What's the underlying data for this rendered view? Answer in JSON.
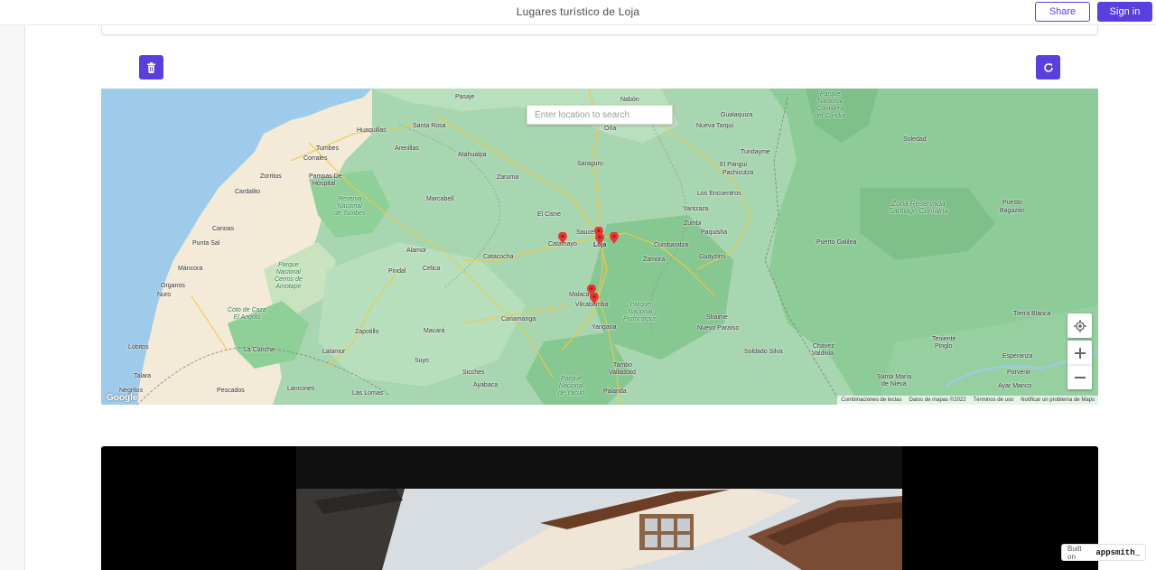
{
  "header": {
    "title": "Lugares turístico de Loja",
    "share_label": "Share",
    "signin_label": "Sign in"
  },
  "toolbar": {
    "delete_icon": "trash-icon",
    "refresh_icon": "refresh-icon"
  },
  "map": {
    "search_placeholder": "Enter location to search",
    "labels": {
      "pasaje": "Pasaje",
      "nabon": "Nabón",
      "gualaquiza": "Gualaquiza",
      "nueva_tarqui": "Nueva Tarqui",
      "huaquillas": "Huaquillas",
      "santa_rosa": "Santa Rosa",
      "ona": "Oña",
      "tumbes": "Tumbes",
      "corrales": "Corrales",
      "arenillas": "Arenillas",
      "atahualpa": "Atahualpa",
      "saraguro": "Saraguro",
      "tundayme": "Tundayme",
      "el_pangui": "El Pangui",
      "pachicutza": "Pachicutza",
      "soledad": "Soledad",
      "zorritos": "Zorritos",
      "pampas": "Pampas De",
      "hospital": "Hospital",
      "zaruma": "Zaruma",
      "cardalito": "Cardalito",
      "marcabeli": "Marcabelí",
      "los_encuentros": "Los Encuentros",
      "yantzaza": "Yantzaza",
      "zumbi": "Zumbi",
      "paquisha": "Paquisha",
      "el_cisne": "El Cisne",
      "canoas": "Canoas",
      "punta_sal": "Punta Sal",
      "catamayo": "Catamayo",
      "sauce": "Sauce",
      "loja": "Loja",
      "cumbaratza": "Cumbaratza",
      "puerto_galilea": "Puerto Galilea",
      "puesto": "Puesto",
      "bagazan": "Bagazán",
      "alamor": "Alamor",
      "catacocha": "Catacocha",
      "zamora": "Zamora",
      "guayzimi": "Guayzimi",
      "mancora": "Máncora",
      "pindal": "Pindal",
      "celica": "Celica",
      "organos": "Organos",
      "nuro": "Nuro",
      "malacatos": "Malacatos",
      "vilcabamba": "Vilcabamba",
      "yangana": "Yangana",
      "cariamanga": "Cariamanga",
      "zapotillo": "Zapotillo",
      "macara": "Macará",
      "shaime": "Shaime",
      "nuevo_paraiso": "Nuevo Paraíso",
      "tierra_blanca": "Tierra Blanca",
      "lobitos": "Lobitos",
      "la_cancha": "La Cancha",
      "lalamor": "Lalamor",
      "suyo": "Suyo",
      "soldado_silva": "Soldado Silva",
      "chavez": "Chávez",
      "valdivia": "Valdivia",
      "teniente": "Teniente",
      "pinglo": "Pinglo",
      "esperanza": "Esperanza",
      "tambo": "Tambo",
      "valladolid": "Valladolid",
      "talara": "Talara",
      "sicches": "Sicches",
      "ayabaca": "Ayabaca",
      "porvenir": "Porvenir",
      "santa_maria": "Santa María",
      "de_nieva": "de Nieva",
      "ayar_manco": "Ayar Manco",
      "negritos": "Negritos",
      "pescados": "Pescados",
      "lancones": "Lancones",
      "las_lomas": "Las Lomas",
      "palanda": "Palanda"
    },
    "parks": {
      "condor": "Parque\nNacional\nCordillera\ndel Cóndor",
      "tumbes": "Reserva\nNacional\nde Tumbes",
      "amotape": "Parque\nNacional\nCerros de\nAmotape",
      "coto": "Coto de Caza\nEl Angolo",
      "podocarpus": "Parque\nNacional\nPodocarpus",
      "santiago": "Zona Reservada\nSantiago Comaina",
      "yacuri": "Parque\nNacional\nde Yacuri"
    },
    "attribution": {
      "shortcuts": "Combinaciones de teclas",
      "data": "Datos de mapas ©2022",
      "terms": "Términos de uso",
      "report": "Notificar un problema de Maps"
    },
    "google": "Google"
  },
  "badge": {
    "built_on": "Built on",
    "brand": "appsmith_"
  },
  "colors": {
    "accent": "#5b3fdc",
    "map_green": "#a8d6b2",
    "water": "#9ecbea",
    "marker": "#e53935"
  }
}
